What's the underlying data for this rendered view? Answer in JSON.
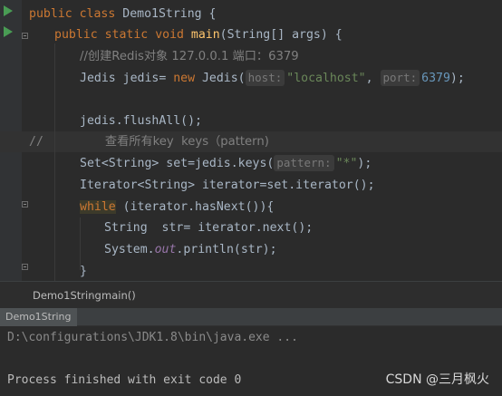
{
  "editor": {
    "lines": {
      "l1": {
        "kw1": "public",
        "kw2": "class",
        "name": "Demo1String",
        "brace": "{"
      },
      "l2": {
        "kw1": "public",
        "kw2": "static",
        "kw3": "void",
        "fn": "main",
        "params": "(String[] args) {"
      },
      "l3": {
        "comment": "//创建Redis对象 127.0.0.1 端口：6379"
      },
      "l4": {
        "type": "Jedis jedis= ",
        "kw": "new",
        "ctor": " Jedis(",
        "hint_host": "host:",
        "str_host": "\"localhost\"",
        "sep": ", ",
        "hint_port": "port:",
        "num_port": "6379",
        "end": ");"
      },
      "l5": {
        "text": ""
      },
      "l6": {
        "text": "jedis.flushAll();"
      },
      "l7": {
        "prefix": "//",
        "comment": "查看所有key  keys（pattern)"
      },
      "l8": {
        "text": "Set<String> set=jedis.keys(",
        "hint": "pattern:",
        "str": "\"*\"",
        "end": ");"
      },
      "l9": {
        "text": "Iterator<String> iterator=set.iterator();"
      },
      "l10": {
        "kw": "while",
        "text": " (iterator.hasNext()){"
      },
      "l11": {
        "text": "String  str= iterator.next();"
      },
      "l12": {
        "pre": "System.",
        "field": "out",
        "post": ".println(str);"
      },
      "l13": {
        "text": "}"
      }
    }
  },
  "breadcrumb": {
    "class_name": "Demo1String",
    "separator": "›",
    "method": "main()"
  },
  "run_panel": {
    "tab": "Demo1String",
    "command": "D:\\configurations\\JDK1.8\\bin\\java.exe ...",
    "finished": "Process finished with exit code 0"
  },
  "watermark": "CSDN @三月枫火",
  "colors": {
    "keyword": "#cc7832",
    "string": "#6a8759",
    "number": "#6897bb",
    "method": "#ffc66d",
    "run_icon": "#499c54"
  }
}
